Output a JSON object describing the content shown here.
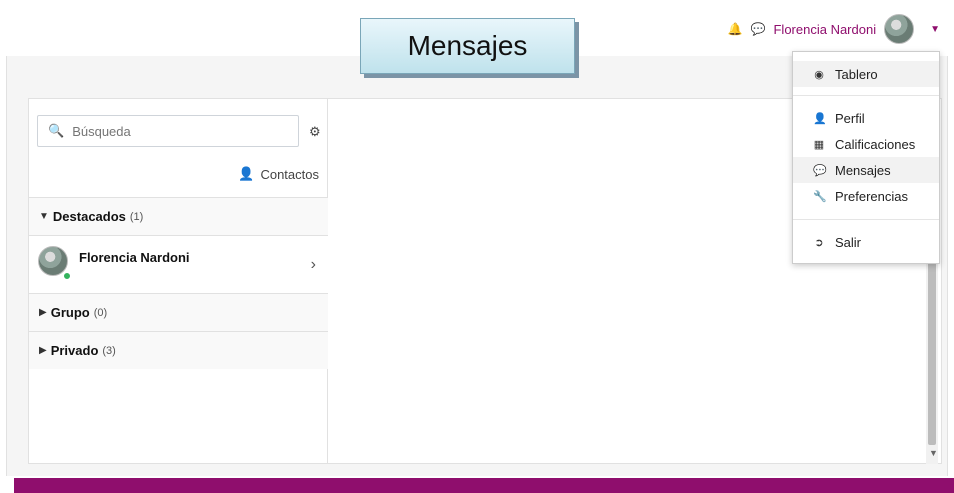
{
  "header": {
    "title": "Mensajes",
    "user_name": "Florencia Nardoni",
    "icons": [
      "bell-icon",
      "chat-icon",
      "avatar",
      "caret-down-icon"
    ]
  },
  "sidebar": {
    "search": {
      "placeholder": "Búsqueda",
      "value": ""
    },
    "contacts_label": "Contactos",
    "sections": [
      {
        "name": "Destacados",
        "count": "(1)",
        "expanded": true
      },
      {
        "name": "Grupo",
        "count": "(0)",
        "expanded": false
      },
      {
        "name": "Privado",
        "count": "(3)",
        "expanded": false
      }
    ],
    "featured_contact": {
      "name": "Florencia Nardoni",
      "online": true
    }
  },
  "user_menu": {
    "items": [
      {
        "label": "Tablero",
        "icon": "dashboard-icon"
      },
      {
        "label": "Perfil",
        "icon": "user-icon"
      },
      {
        "label": "Calificaciones",
        "icon": "table-icon"
      },
      {
        "label": "Mensajes",
        "icon": "chat-icon"
      },
      {
        "label": "Preferencias",
        "icon": "wrench-icon"
      },
      {
        "label": "Salir",
        "icon": "sign-out-icon"
      }
    ]
  },
  "colors": {
    "brand": "#8f0e6d",
    "online": "#35b35e",
    "title_bg": "#bfe2ec"
  }
}
